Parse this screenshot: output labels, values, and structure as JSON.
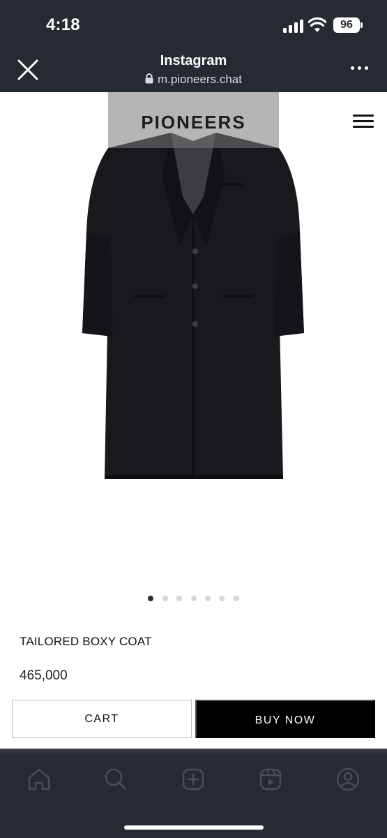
{
  "status_bar": {
    "time": "4:18",
    "battery": "96",
    "icons": [
      "signal-icon",
      "wifi-icon",
      "battery-icon"
    ]
  },
  "browser_header": {
    "title": "Instagram",
    "url": "m.pioneers.chat",
    "icons": [
      "close-icon",
      "lock-icon",
      "more-icon"
    ]
  },
  "site": {
    "logo": "PIONEERS",
    "menu_icon": "hamburger-menu-icon"
  },
  "gallery": {
    "image_count": 7,
    "active_index": 0
  },
  "product": {
    "name": "TAILORED BOXY COAT",
    "price": "465,000"
  },
  "actions": {
    "cart_label": "CART",
    "buy_label": "BUY NOW"
  },
  "tabbar": {
    "icons": [
      "home-icon",
      "search-icon",
      "create-icon",
      "reels-icon",
      "profile-icon"
    ]
  },
  "colors": {
    "chrome": "#262a32",
    "buy_button": "#000000",
    "text": "#111111"
  }
}
